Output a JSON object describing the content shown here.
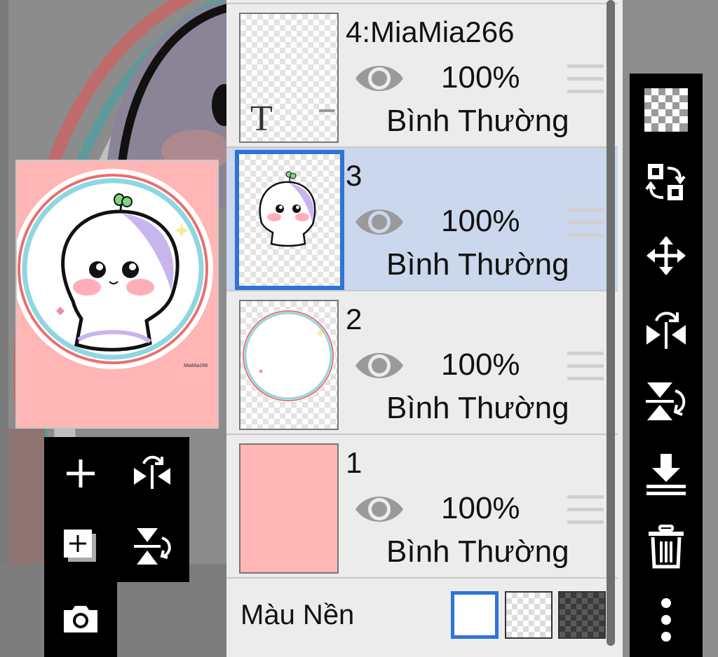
{
  "layers": [
    {
      "name": "4:MiaMia266",
      "opacity": "100%",
      "blend_mode": "Bình Thường",
      "selected": false,
      "thumb": "text-layer"
    },
    {
      "name": "3",
      "opacity": "100%",
      "blend_mode": "Bình Thường",
      "selected": true,
      "thumb": "character"
    },
    {
      "name": "2",
      "opacity": "100%",
      "blend_mode": "Bình Thường",
      "selected": false,
      "thumb": "circle-frame"
    },
    {
      "name": "1",
      "opacity": "100%",
      "blend_mode": "Bình Thường",
      "selected": false,
      "thumb": "pink-fill"
    }
  ],
  "background_color": {
    "label": "Màu Nền",
    "options": [
      "white",
      "transparent-checker",
      "dark-checker"
    ],
    "selected": "white"
  },
  "text_layer_glyph": "T",
  "preview_signature": "MiaMia266",
  "colors": {
    "selection_blue": "#2f73d9",
    "selected_row": "#cbd7ec",
    "preview_pink": "#ffb6b4",
    "panel_bg": "#ececec"
  },
  "left_toolbar_icons": [
    "plus-icon",
    "flip-horizontal-icon",
    "duplicate-layer-icon",
    "flip-vertical-icon",
    "camera-icon"
  ],
  "right_toolbar_icons": [
    "transparency-checker-icon",
    "swap-layer-icon",
    "move-icon",
    "flip-horizontal-icon",
    "flip-vertical-icon",
    "merge-down-icon",
    "trash-icon",
    "more-vertical-icon"
  ]
}
